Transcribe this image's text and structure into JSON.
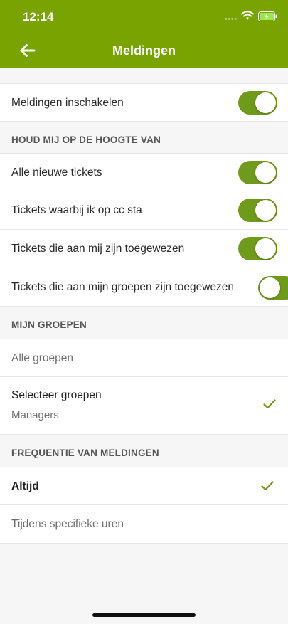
{
  "status_bar": {
    "time": "12:14",
    "signal_dots": "••••"
  },
  "nav": {
    "title": "Meldingen",
    "back_icon": "arrow-left-icon"
  },
  "settings": {
    "enable_label": "Meldingen inschakelen",
    "enable_on": true
  },
  "keep_me_updated": {
    "header": "HOUD MIJ OP DE HOOGTE VAN",
    "items": [
      {
        "label": "Alle nieuwe tickets",
        "on": true
      },
      {
        "label": "Tickets waarbij ik op cc sta",
        "on": true
      },
      {
        "label": "Tickets die aan mij zijn toegewezen",
        "on": true
      },
      {
        "label": "Tickets die aan mijn groepen zijn toegewezen",
        "on": true
      }
    ]
  },
  "my_groups": {
    "header": "MIJN GROEPEN",
    "all_groups": "Alle groepen",
    "select_groups": "Selecteer groepen",
    "selected_group": "Managers"
  },
  "frequency": {
    "header": "FREQUENTIE VAN MELDINGEN",
    "always": "Altijd",
    "specific_hours": "Tijdens specifieke uren"
  },
  "colors": {
    "brand_green": "#78a300",
    "toggle_green": "#6f9a1c",
    "check_green": "#6f9a1c"
  }
}
